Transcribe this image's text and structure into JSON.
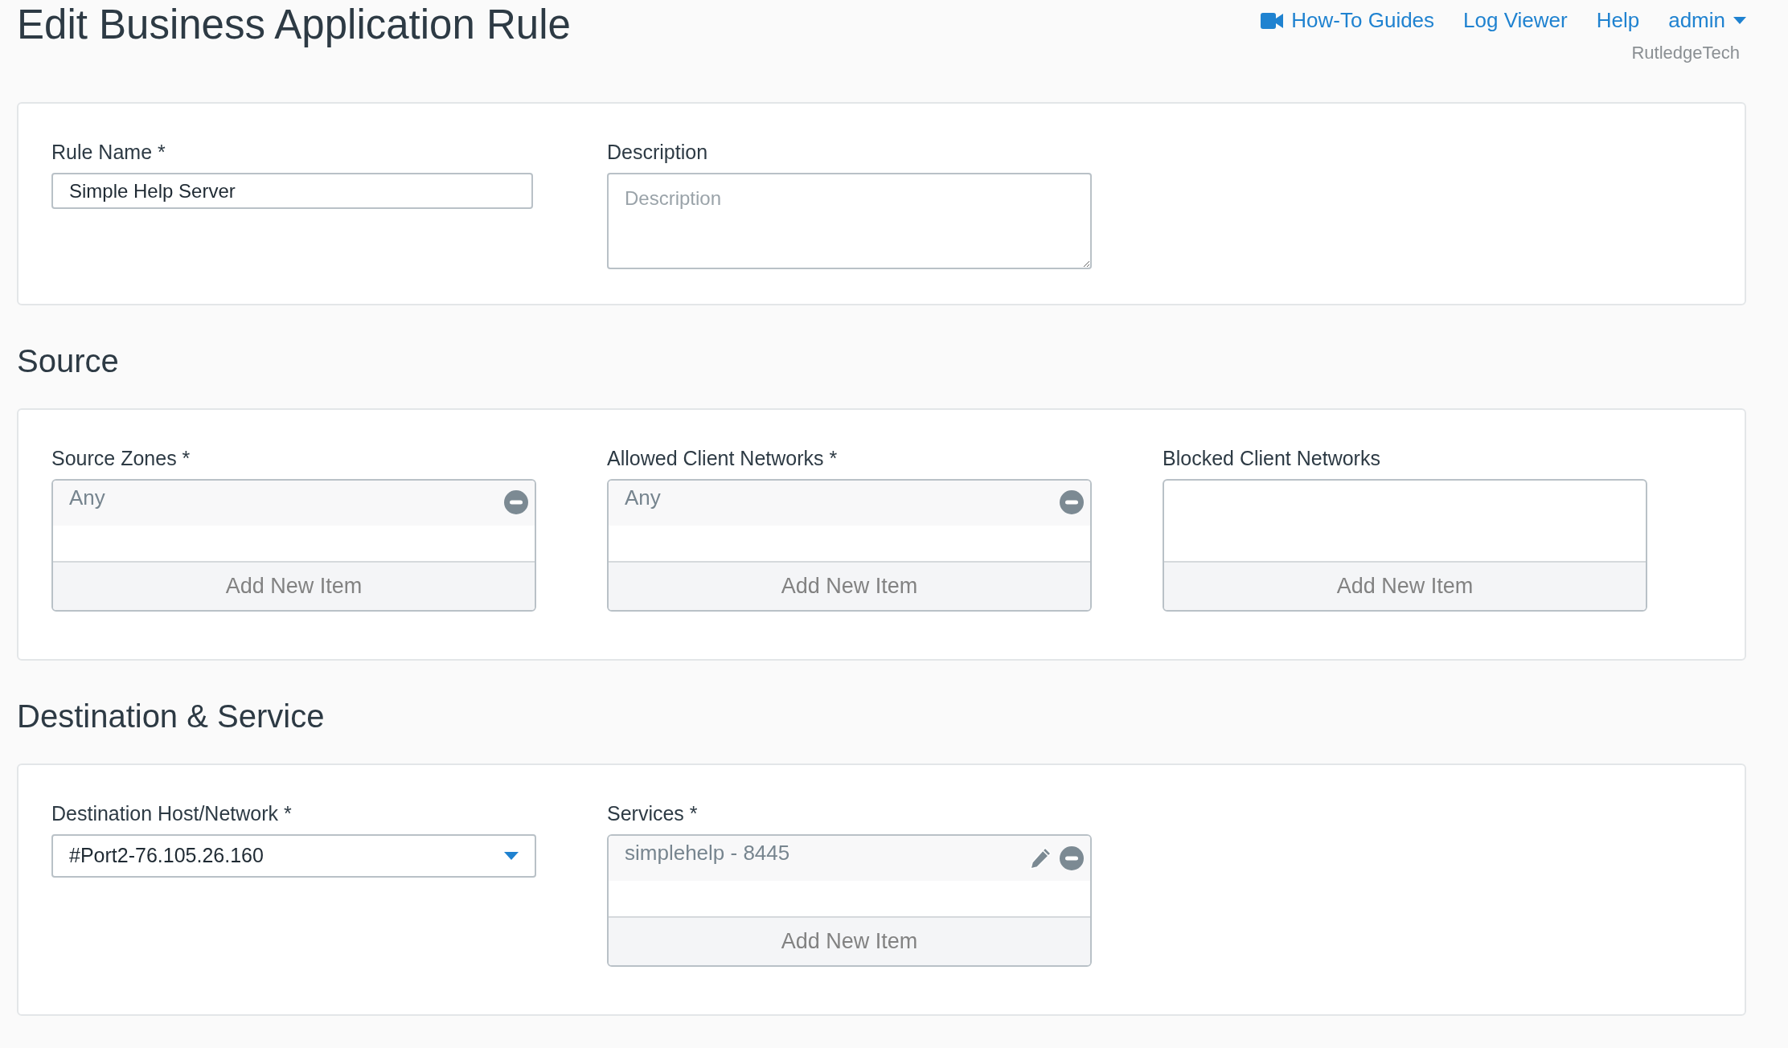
{
  "page_title": "Edit Business Application Rule",
  "nav": {
    "links": [
      {
        "label": "How-To Guides"
      },
      {
        "label": "Log Viewer"
      },
      {
        "label": "Help"
      }
    ],
    "user": "admin",
    "org": "RutledgeTech"
  },
  "general": {
    "fields": [
      {
        "kind": "input",
        "label": "Rule Name *",
        "value": "Simple Help Server"
      },
      {
        "kind": "textarea",
        "label": "Description",
        "placeholder": "Description"
      }
    ]
  },
  "sections": [
    {
      "heading": "Source",
      "fields": [
        {
          "kind": "list",
          "label": "Source Zones *",
          "items": [
            {
              "text": "Any",
              "editable": false
            }
          ],
          "add_label": "Add New Item"
        },
        {
          "kind": "list",
          "label": "Allowed Client Networks *",
          "items": [
            {
              "text": "Any",
              "editable": false
            }
          ],
          "add_label": "Add New Item"
        },
        {
          "kind": "list",
          "label": "Blocked Client Networks",
          "add_label": "Add New Item"
        }
      ]
    },
    {
      "heading": "Destination & Service",
      "fields": [
        {
          "kind": "select",
          "label": "Destination Host/Network *",
          "value": "#Port2-76.105.26.160"
        },
        {
          "kind": "list",
          "label": "Services *",
          "items": [
            {
              "text": "simplehelp - 8445",
              "editable": true
            }
          ],
          "add_label": "Add New Item"
        }
      ]
    }
  ]
}
